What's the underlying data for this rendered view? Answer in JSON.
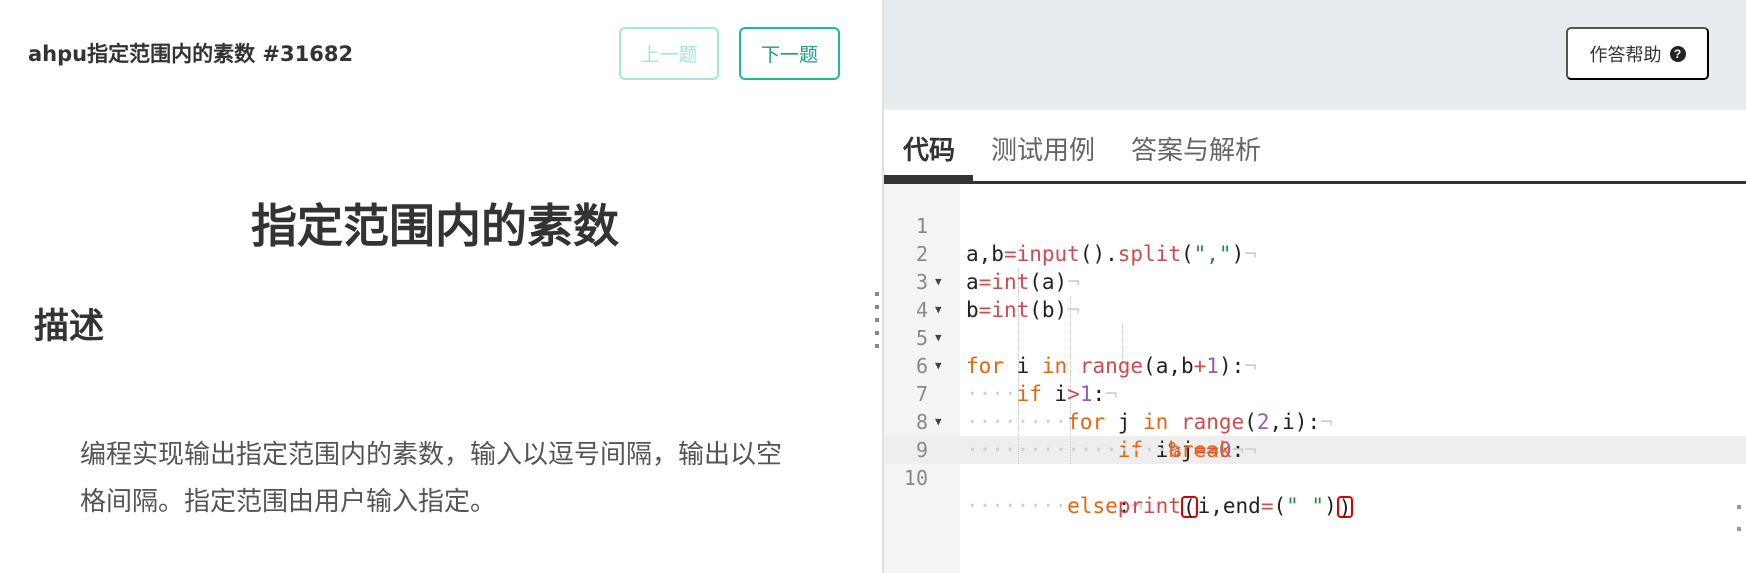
{
  "problem": {
    "header": "ahpu指定范围内的素数 #31682",
    "prev_label": "上一题",
    "next_label": "下一题",
    "title": "指定范围内的素数",
    "section_heading": "描述",
    "description_line1": "编程实现输出指定范围内的素数，输入以逗号间隔，输出以空",
    "description_line2": "格间隔。指定范围由用户输入指定。"
  },
  "toolbar": {
    "help_label": "作答帮助",
    "help_icon": "question-circle-icon"
  },
  "tabs": [
    {
      "label": "代码",
      "active": true
    },
    {
      "label": "测试用例",
      "active": false
    },
    {
      "label": "答案与解析",
      "active": false
    }
  ],
  "editor": {
    "active_line": 10,
    "lines": [
      {
        "n": "1",
        "text": "a,b=input().split(\",\")"
      },
      {
        "n": "2",
        "text": "a=int(a)"
      },
      {
        "n": "3",
        "text": "b=int(b)"
      },
      {
        "n": "4",
        "text": "for i in range(a,b+1):"
      },
      {
        "n": "5",
        "text": "    if i>1:"
      },
      {
        "n": "6",
        "text": "        for j in range(2,i):"
      },
      {
        "n": "7",
        "text": "            if i%j==0:"
      },
      {
        "n": "8",
        "text": "                break"
      },
      {
        "n": "9",
        "text": "        else:"
      },
      {
        "n": "10",
        "text": "            print(i,end=(\" \"))"
      }
    ]
  },
  "colors": {
    "accent": "#1abc9c",
    "keyword": "#e8650e",
    "function": "#d14a4f",
    "number": "#9b59b6",
    "string": "#2e8b3d"
  }
}
